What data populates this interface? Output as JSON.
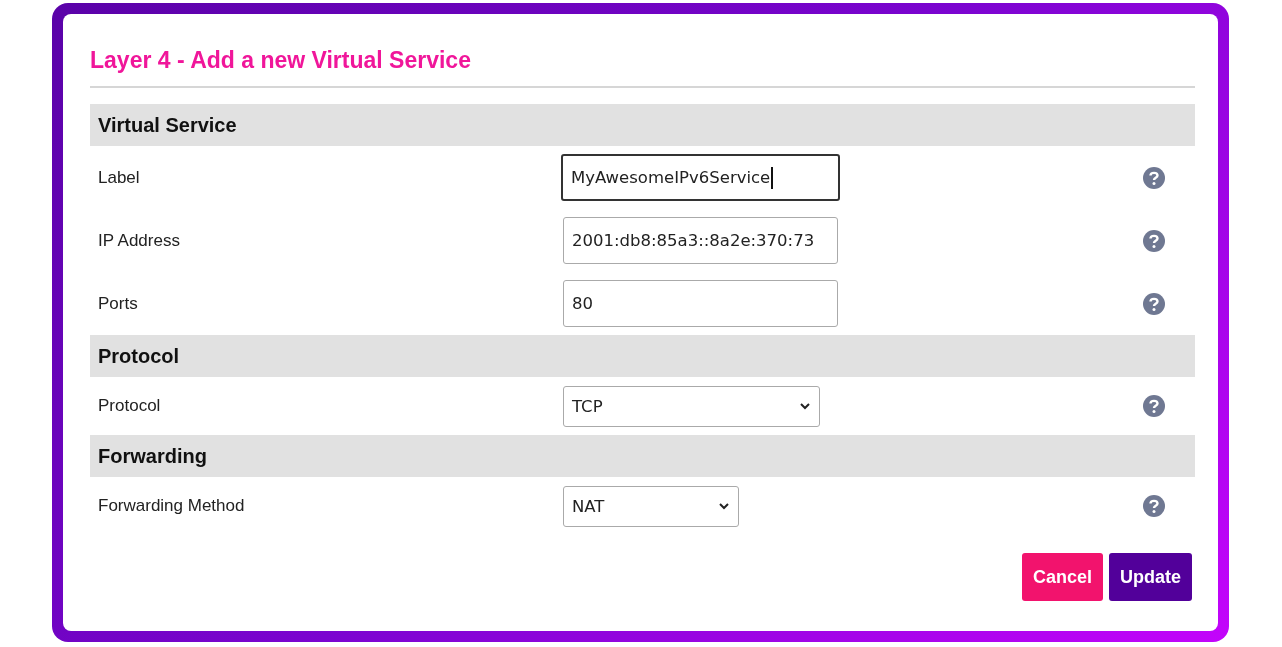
{
  "title": "Layer 4 - Add a new Virtual Service",
  "sections": [
    {
      "heading": "Virtual Service",
      "rows": [
        {
          "kind": "text",
          "label": "Label",
          "value": "MyAwesomeIPv6Service",
          "focused": true
        },
        {
          "kind": "text",
          "label": "IP Address",
          "value": "2001:db8:85a3::8a2e:370:73",
          "focused": false
        },
        {
          "kind": "text",
          "label": "Ports",
          "value": "80",
          "focused": false
        }
      ]
    },
    {
      "heading": "Protocol",
      "rows": [
        {
          "kind": "select",
          "label": "Protocol",
          "value": "TCP",
          "focused": false
        }
      ]
    },
    {
      "heading": "Forwarding",
      "rows": [
        {
          "kind": "select",
          "label": "Forwarding Method",
          "value": "NAT",
          "focused": false
        }
      ]
    }
  ],
  "buttons": [
    {
      "kind": "cancel",
      "label": "Cancel"
    },
    {
      "kind": "primary",
      "label": "Update"
    }
  ]
}
